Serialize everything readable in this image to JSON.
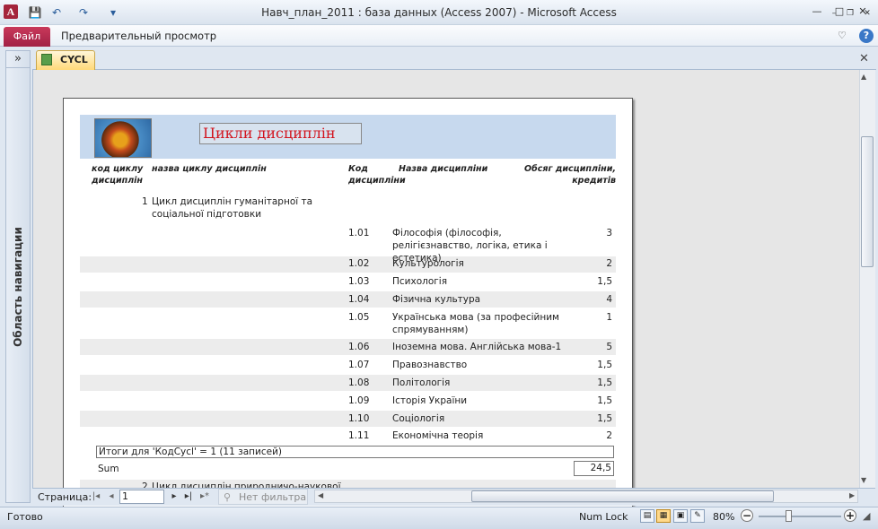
{
  "window": {
    "title": "Навч_план_2011 : база данных (Access 2007)  -  Microsoft Access",
    "app_icon": "A",
    "controls": {
      "minimize": "—",
      "maximize": "□",
      "close": "✕"
    },
    "inner_controls": {
      "minimize": "–",
      "restore": "❐",
      "close": "✕"
    }
  },
  "quick_access": {
    "save_icon": "💾",
    "undo_icon": "↶",
    "redo_icon": "↷",
    "customize_icon": "▾"
  },
  "ribbon": {
    "file_tab": "Файл",
    "preview_tab": "Предварительный просмотр",
    "collapse_icon": "♡",
    "help_icon": "?"
  },
  "nav_pane": {
    "label": "Область навигации",
    "expand": "»"
  },
  "doc_tab": {
    "label": "CYCL",
    "close": "✕"
  },
  "report": {
    "title": "Цикли дисциплін",
    "headers": {
      "cycle_code": "код циклу дисциплін",
      "cycle_name": "назва циклу дисциплін",
      "disc_code": "Код дисципліни",
      "disc_name": "Назва дисципліни",
      "credits": "Обсяг дисципліни, кредитів"
    },
    "group1": {
      "code": "1",
      "name": "Цикл дисциплін гуманітарної та соціальної підготовки"
    },
    "rows": [
      {
        "code": "1.01",
        "name": "Філософія (філософія, релігієзнавство, логіка, етика і естетика)",
        "credits": "3"
      },
      {
        "code": "1.02",
        "name": "Культурологія",
        "credits": "2"
      },
      {
        "code": "1.03",
        "name": "Психологія",
        "credits": "1,5"
      },
      {
        "code": "1.04",
        "name": "Фізична культура",
        "credits": "4"
      },
      {
        "code": "1.05",
        "name": "Українська мова (за професійним спрямуванням)",
        "credits": "1"
      },
      {
        "code": "1.06",
        "name": "Іноземна мова. Англійська мова-1",
        "credits": "5"
      },
      {
        "code": "1.07",
        "name": "Правознавство",
        "credits": "1,5"
      },
      {
        "code": "1.08",
        "name": "Політологія",
        "credits": "1,5"
      },
      {
        "code": "1.09",
        "name": "Історія України",
        "credits": "1,5"
      },
      {
        "code": "1.10",
        "name": "Соціологія",
        "credits": "1,5"
      },
      {
        "code": "1.11",
        "name": "Економічна теорія",
        "credits": "2"
      }
    ],
    "totals": "Итоги для 'КодCycl' =  1 (11 записей)",
    "sum_label": "Sum",
    "sum_value": "24,5",
    "group2": {
      "code": "2",
      "name": "Цикл дисциплін природничо-наукової"
    }
  },
  "pager": {
    "label": "Страница:",
    "first": "|◂",
    "prev": "◂",
    "value": "1",
    "next": "▸",
    "last": "▸|",
    "new": "▸*",
    "filter": "Нет фильтра",
    "filter_icon": "⚲"
  },
  "status": {
    "text": "Готово",
    "numlock": "Num Lock",
    "zoom": "80%",
    "zoom_level_percent": 80
  }
}
